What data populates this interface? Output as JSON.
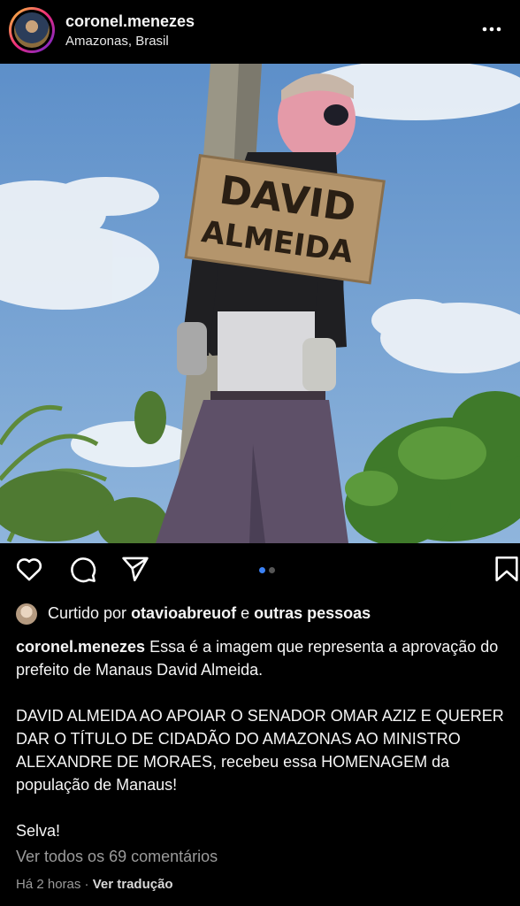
{
  "header": {
    "username": "coronel.menezes",
    "location": "Amazonas, Brasil"
  },
  "photo": {
    "sign_line1": "DAVID",
    "sign_line2": "ALMEIDA"
  },
  "carousel": {
    "count": 2,
    "active": 1
  },
  "likes": {
    "prefix": "Curtido por",
    "user": "otavioabreuof",
    "conjunction": "e",
    "others": "outras pessoas"
  },
  "caption": {
    "username": "coronel.menezes",
    "line1": "Essa é a imagem que representa a aprovação do prefeito de Manaus David Almeida.",
    "para2": "DAVID ALMEIDA AO APOIAR O SENADOR OMAR AZIZ E QUERER DAR O TÍTULO DE CIDADÃO DO AMAZONAS AO MINISTRO ALEXANDRE DE MORAES, recebeu essa HOMENAGEM da população de Manaus!",
    "para3": "Selva!"
  },
  "comments": {
    "view_all": "Ver todos os 69 comentários"
  },
  "footer": {
    "time": "Há 2 horas",
    "separator": "·",
    "translate": "Ver tradução"
  },
  "colors": {
    "background": "#000000",
    "text": "#f5f5f5",
    "muted": "#9b9b9b",
    "carousel_active": "#3b82f6"
  }
}
